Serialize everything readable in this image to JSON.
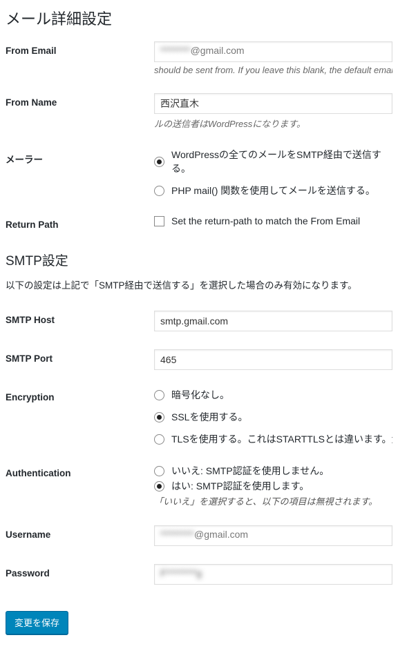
{
  "headings": {
    "mail_detail": "メール詳細設定",
    "smtp_settings": "SMTP設定"
  },
  "labels": {
    "from_email": "From Email",
    "from_name": "From Name",
    "mailer": "メーラー",
    "return_path": "Return Path",
    "smtp_host": "SMTP Host",
    "smtp_port": "SMTP Port",
    "encryption": "Encryption",
    "authentication": "Authentication",
    "username": "Username",
    "password": "Password"
  },
  "values": {
    "from_email_masked": "********",
    "from_email_suffix": "@gmail.com",
    "from_name": "西沢直木",
    "smtp_host": "smtp.gmail.com",
    "smtp_port": "465",
    "username_masked": "*********",
    "username_suffix": "@gmail.com",
    "password_masked": "F********g"
  },
  "descriptions": {
    "from_email": "should be sent from. If you leave this blank, the default email w",
    "from_name": "ルの送信者はWordPressになります。",
    "smtp_note": "以下の設定は上記で「SMTP経由で送信する」を選択した場合のみ有効になります。",
    "auth_note": "「いいえ」を選択すると、以下の項目は無視されます。"
  },
  "mailer": {
    "opt_smtp": "WordPressの全てのメールをSMTP経由で送信する。",
    "opt_php": "PHP mail() 関数を使用してメールを送信する。",
    "selected": "smtp"
  },
  "return_path": {
    "label": "Set the return-path to match the From Email",
    "checked": false
  },
  "encryption": {
    "opt_none": "暗号化なし。",
    "opt_ssl": "SSLを使用する。",
    "opt_tls": "TLSを使用する。これはSTARTTLSとは違います。大多数の",
    "selected": "ssl"
  },
  "authentication": {
    "opt_no": "いいえ: SMTP認証を使用しません。",
    "opt_yes": "はい: SMTP認証を使用します。",
    "selected": "yes"
  },
  "buttons": {
    "save": "変更を保存"
  }
}
